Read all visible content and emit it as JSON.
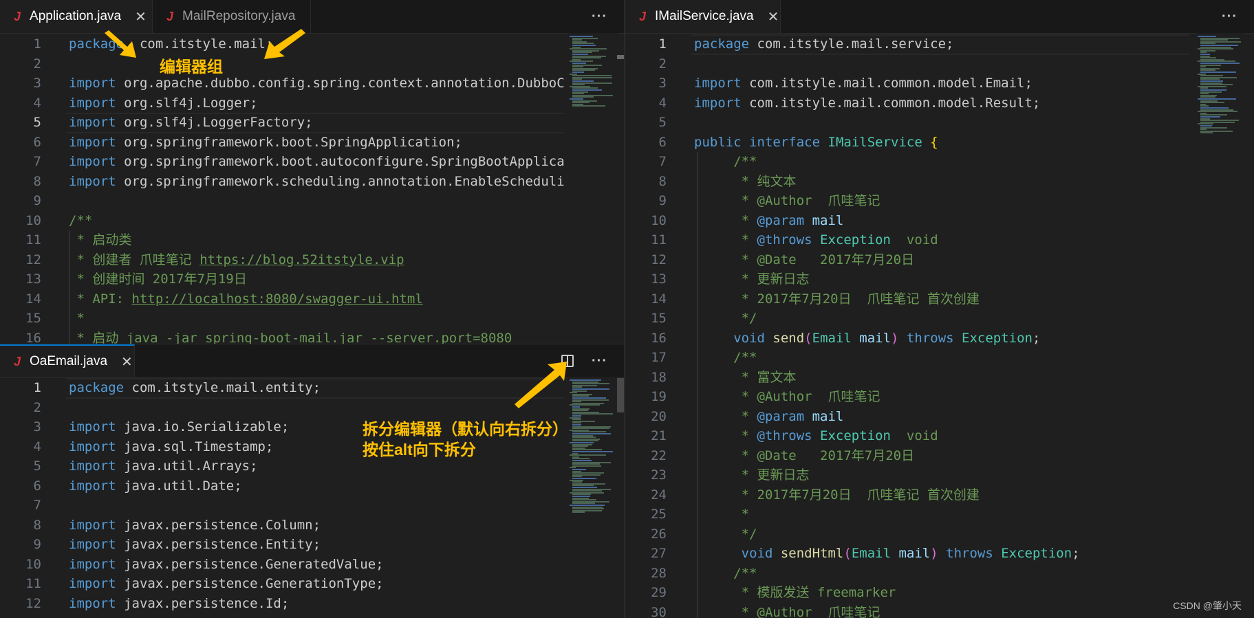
{
  "left_top": {
    "tabs": [
      {
        "name": "Application.java",
        "active": true
      },
      {
        "name": "MailRepository.java",
        "active": false
      }
    ],
    "more_label": "···",
    "lines": [
      {
        "n": "1",
        "t": [
          [
            "kw",
            "package"
          ],
          [
            "",
            "  com.itstyle.mail;"
          ]
        ]
      },
      {
        "n": "2",
        "t": []
      },
      {
        "n": "3",
        "t": [
          [
            "kw",
            "import"
          ],
          [
            "",
            " org.apache.dubbo.config.spring.context.annotation.DubboC"
          ]
        ]
      },
      {
        "n": "4",
        "t": [
          [
            "kw",
            "import"
          ],
          [
            "",
            " org.slf4j.Logger;"
          ]
        ]
      },
      {
        "n": "5",
        "cur": true,
        "t": [
          [
            "kw",
            "import"
          ],
          [
            "",
            " org.slf4j.LoggerFactory;"
          ]
        ]
      },
      {
        "n": "6",
        "t": [
          [
            "kw",
            "import"
          ],
          [
            "",
            " org.springframework.boot.SpringApplication;"
          ]
        ]
      },
      {
        "n": "7",
        "t": [
          [
            "kw",
            "import"
          ],
          [
            "",
            " org.springframework.boot.autoconfigure.SpringBootApplica"
          ]
        ]
      },
      {
        "n": "8",
        "t": [
          [
            "kw",
            "import"
          ],
          [
            "",
            " org.springframework.scheduling.annotation.EnableScheduli"
          ]
        ]
      },
      {
        "n": "9",
        "t": []
      },
      {
        "n": "10",
        "t": [
          [
            "cm",
            "/**"
          ]
        ]
      },
      {
        "n": "11",
        "t": [
          [
            "cm",
            " * 启动类"
          ]
        ]
      },
      {
        "n": "12",
        "t": [
          [
            "cm",
            " * 创建者 爪哇笔记 "
          ],
          [
            "url",
            "https://blog.52itstyle.vip"
          ]
        ]
      },
      {
        "n": "13",
        "t": [
          [
            "cm",
            " * 创建时间 2017年7月19日"
          ]
        ]
      },
      {
        "n": "14",
        "t": [
          [
            "cm",
            " * API: "
          ],
          [
            "url",
            "http://localhost:8080/swagger-ui.html"
          ]
        ]
      },
      {
        "n": "15",
        "t": [
          [
            "cm",
            " *"
          ]
        ]
      },
      {
        "n": "16",
        "t": [
          [
            "cm",
            " * 启动 java -jar spring-boot-mail.jar --server.port=8080"
          ]
        ]
      }
    ]
  },
  "left_bottom": {
    "tabs": [
      {
        "name": "OaEmail.java",
        "active": true
      }
    ],
    "more_label": "···",
    "lines": [
      {
        "n": "1",
        "cur": true,
        "t": [
          [
            "kw",
            "package"
          ],
          [
            "",
            " com.itstyle.mail.entity;"
          ]
        ]
      },
      {
        "n": "2",
        "t": []
      },
      {
        "n": "3",
        "t": [
          [
            "kw",
            "import"
          ],
          [
            "",
            " java.io.Serializable;"
          ]
        ]
      },
      {
        "n": "4",
        "t": [
          [
            "kw",
            "import"
          ],
          [
            "",
            " java.sql.Timestamp;"
          ]
        ]
      },
      {
        "n": "5",
        "t": [
          [
            "kw",
            "import"
          ],
          [
            "",
            " java.util.Arrays;"
          ]
        ]
      },
      {
        "n": "6",
        "t": [
          [
            "kw",
            "import"
          ],
          [
            "",
            " java.util.Date;"
          ]
        ]
      },
      {
        "n": "7",
        "t": []
      },
      {
        "n": "8",
        "t": [
          [
            "kw",
            "import"
          ],
          [
            "",
            " javax.persistence.Column;"
          ]
        ]
      },
      {
        "n": "9",
        "t": [
          [
            "kw",
            "import"
          ],
          [
            "",
            " javax.persistence.Entity;"
          ]
        ]
      },
      {
        "n": "10",
        "t": [
          [
            "kw",
            "import"
          ],
          [
            "",
            " javax.persistence.GeneratedValue;"
          ]
        ]
      },
      {
        "n": "11",
        "t": [
          [
            "kw",
            "import"
          ],
          [
            "",
            " javax.persistence.GenerationType;"
          ]
        ]
      },
      {
        "n": "12",
        "t": [
          [
            "kw",
            "import"
          ],
          [
            "",
            " javax.persistence.Id;"
          ]
        ]
      }
    ]
  },
  "right": {
    "tabs": [
      {
        "name": "IMailService.java",
        "active": true
      }
    ],
    "more_label": "···",
    "lines": [
      {
        "n": "1",
        "cur": true,
        "t": [
          [
            "kw",
            "package"
          ],
          [
            "",
            " com.itstyle.mail.service;"
          ]
        ]
      },
      {
        "n": "2",
        "t": []
      },
      {
        "n": "3",
        "t": [
          [
            "kw",
            "import"
          ],
          [
            "",
            " com.itstyle.mail.common.model.Email;"
          ]
        ]
      },
      {
        "n": "4",
        "t": [
          [
            "kw",
            "import"
          ],
          [
            "",
            " com.itstyle.mail.common.model.Result;"
          ]
        ]
      },
      {
        "n": "5",
        "t": []
      },
      {
        "n": "6",
        "t": [
          [
            "kw",
            "public"
          ],
          [
            "",
            " "
          ],
          [
            "kw",
            "interface"
          ],
          [
            "",
            " "
          ],
          [
            "ty",
            "IMailService"
          ],
          [
            "",
            " "
          ],
          [
            "br",
            "{"
          ]
        ]
      },
      {
        "n": "7",
        "t": [
          [
            "cm",
            "     /**"
          ]
        ]
      },
      {
        "n": "8",
        "t": [
          [
            "cm",
            "      * 纯文本"
          ]
        ]
      },
      {
        "n": "9",
        "t": [
          [
            "cm",
            "      * @Author  爪哇笔记"
          ]
        ]
      },
      {
        "n": "10",
        "t": [
          [
            "cm",
            "      * "
          ],
          [
            "kw",
            "@param"
          ],
          [
            "",
            " "
          ],
          [
            "vr",
            "mail"
          ]
        ]
      },
      {
        "n": "11",
        "t": [
          [
            "cm",
            "      * "
          ],
          [
            "kw",
            "@throws"
          ],
          [
            "",
            " "
          ],
          [
            "ty",
            "Exception"
          ],
          [
            "cm",
            "  void"
          ]
        ]
      },
      {
        "n": "12",
        "t": [
          [
            "cm",
            "      * @Date   2017年7月20日"
          ]
        ]
      },
      {
        "n": "13",
        "t": [
          [
            "cm",
            "      * 更新日志"
          ]
        ]
      },
      {
        "n": "14",
        "t": [
          [
            "cm",
            "      * 2017年7月20日  爪哇笔记 首次创建"
          ]
        ]
      },
      {
        "n": "15",
        "t": [
          [
            "cm",
            "      */"
          ]
        ]
      },
      {
        "n": "16",
        "t": [
          [
            "kw",
            "     void"
          ],
          [
            "",
            " "
          ],
          [
            "fn",
            "send"
          ],
          [
            "br2",
            "("
          ],
          [
            "ty",
            "Email"
          ],
          [
            "",
            " "
          ],
          [
            "vr",
            "mail"
          ],
          [
            "br2",
            ")"
          ],
          [
            "",
            " "
          ],
          [
            "kw",
            "throws"
          ],
          [
            "",
            " "
          ],
          [
            "ty",
            "Exception"
          ],
          [
            "",
            ";"
          ]
        ]
      },
      {
        "n": "17",
        "t": [
          [
            "cm",
            "     /**"
          ]
        ]
      },
      {
        "n": "18",
        "t": [
          [
            "cm",
            "      * 富文本"
          ]
        ]
      },
      {
        "n": "19",
        "t": [
          [
            "cm",
            "      * @Author  爪哇笔记"
          ]
        ]
      },
      {
        "n": "20",
        "t": [
          [
            "cm",
            "      * "
          ],
          [
            "kw",
            "@param"
          ],
          [
            "",
            " "
          ],
          [
            "vr",
            "mail"
          ]
        ]
      },
      {
        "n": "21",
        "t": [
          [
            "cm",
            "      * "
          ],
          [
            "kw",
            "@throws"
          ],
          [
            "",
            " "
          ],
          [
            "ty",
            "Exception"
          ],
          [
            "cm",
            "  void"
          ]
        ]
      },
      {
        "n": "22",
        "t": [
          [
            "cm",
            "      * @Date   2017年7月20日"
          ]
        ]
      },
      {
        "n": "23",
        "t": [
          [
            "cm",
            "      * 更新日志"
          ]
        ]
      },
      {
        "n": "24",
        "t": [
          [
            "cm",
            "      * 2017年7月20日  爪哇笔记 首次创建"
          ]
        ]
      },
      {
        "n": "25",
        "t": [
          [
            "cm",
            "      *"
          ]
        ]
      },
      {
        "n": "26",
        "t": [
          [
            "cm",
            "      */"
          ]
        ]
      },
      {
        "n": "27",
        "t": [
          [
            "kw",
            "      void"
          ],
          [
            "",
            " "
          ],
          [
            "fn",
            "sendHtml"
          ],
          [
            "br2",
            "("
          ],
          [
            "ty",
            "Email"
          ],
          [
            "",
            " "
          ],
          [
            "vr",
            "mail"
          ],
          [
            "br2",
            ")"
          ],
          [
            "",
            " "
          ],
          [
            "kw",
            "throws"
          ],
          [
            "",
            " "
          ],
          [
            "ty",
            "Exception"
          ],
          [
            "",
            ";"
          ]
        ]
      },
      {
        "n": "28",
        "t": [
          [
            "cm",
            "     /**"
          ]
        ]
      },
      {
        "n": "29",
        "t": [
          [
            "cm",
            "      * 模版发送 freemarker"
          ]
        ]
      },
      {
        "n": "30",
        "t": [
          [
            "cm",
            "      * @Author  爪哇笔记"
          ]
        ]
      }
    ]
  },
  "annotations": {
    "editor_group": "编辑器组",
    "split_line1": "拆分编辑器（默认向右拆分）",
    "split_line2": "按住alt向下拆分"
  },
  "watermark": "CSDN @肇小天",
  "colors": {
    "annotation": "#ffc000",
    "keyword": "#569cd6",
    "comment": "#6a9955",
    "type": "#4ec9b0",
    "java_icon": "#d13438"
  }
}
